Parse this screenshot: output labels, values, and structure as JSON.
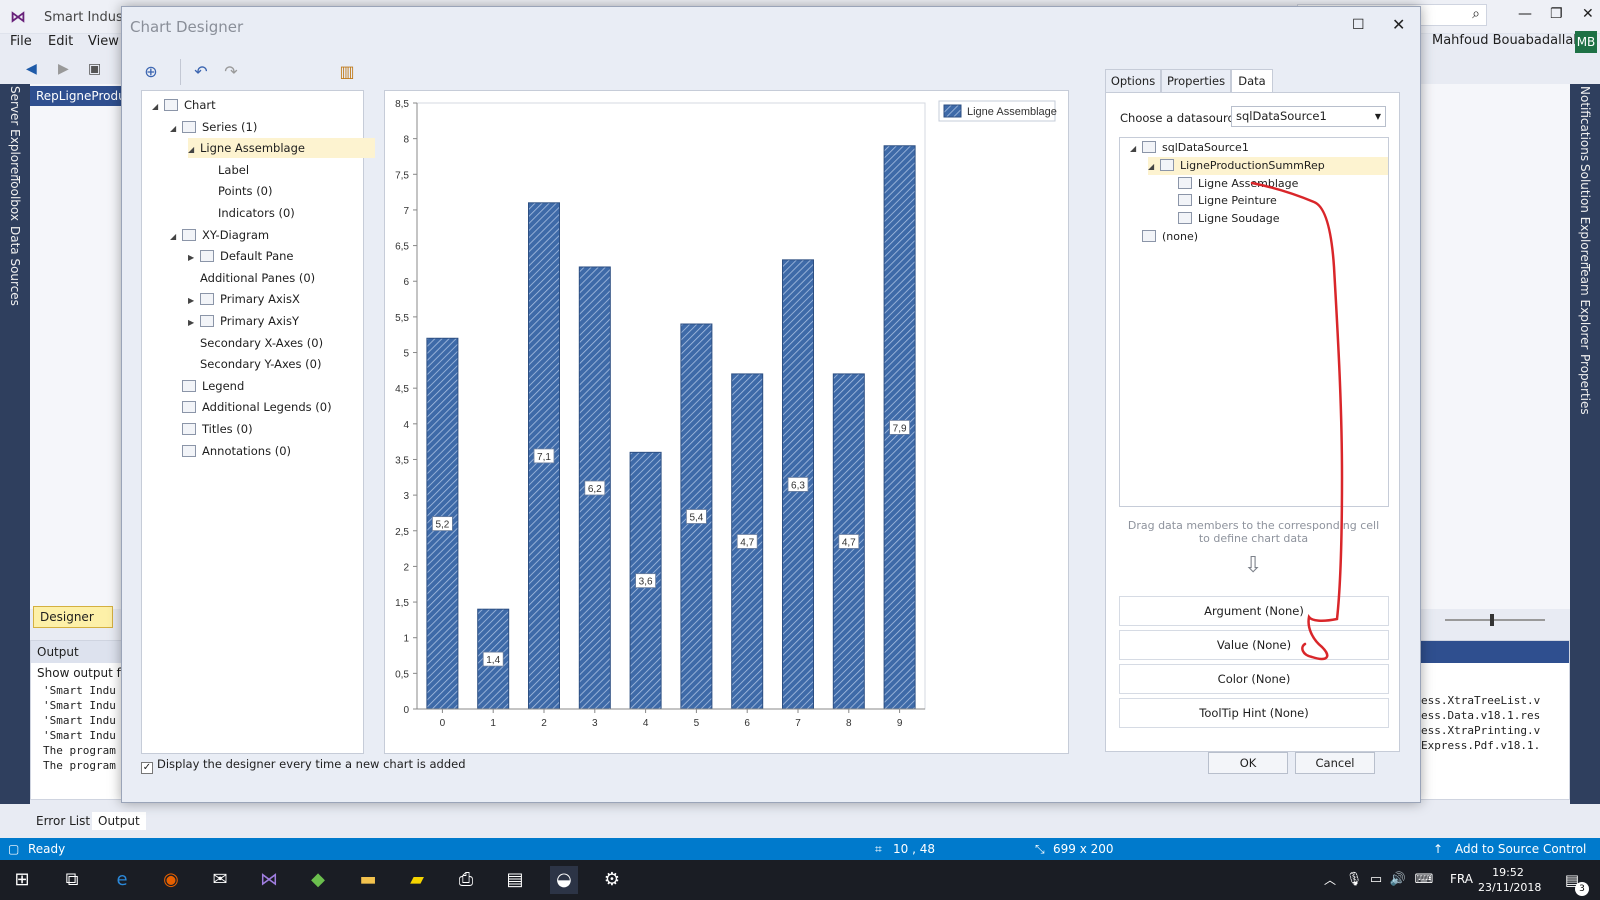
{
  "vs": {
    "app_title": "Smart Industria",
    "menu": [
      "File",
      "Edit",
      "View"
    ],
    "user": "Mahfoud Bouabadallah",
    "user_initials": "MB",
    "doc_tab": "RepLigneProduc",
    "left_strip": [
      "Server Explorer",
      "Toolbox",
      "Data Sources"
    ],
    "right_strip": [
      "Notifications",
      "Solution Explorer",
      "Team Explorer",
      "Properties"
    ],
    "designer_tab": "Designer",
    "output": {
      "title": "Output",
      "show_from": "Show output fro",
      "lines": [
        "'Smart Indu",
        "'Smart Indu",
        "'Smart Indu",
        "'Smart Indu",
        "The program",
        "The program"
      ],
      "right_lines": [
        "ess.XtraTreeList.v",
        "ess.Data.v18.1.res",
        "ess.XtraPrinting.v",
        "Express.Pdf.v18.1."
      ]
    },
    "bottom_tabs": [
      "Error List",
      "Output"
    ],
    "status": {
      "ready": "Ready",
      "position": "10 , 48",
      "size": "699 x 200",
      "source_control": "Add to Source Control"
    },
    "taskbar": {
      "lang": "FRA",
      "time": "19:52",
      "date": "23/11/2018",
      "badge": "3"
    }
  },
  "dialog": {
    "title": "Chart Designer",
    "tree": [
      {
        "label": "Chart",
        "arrow": "◢"
      },
      {
        "label": "Series (1)",
        "arrow": "◢"
      },
      {
        "label": "Ligne Assemblage",
        "arrow": "◢"
      },
      {
        "label": "Label",
        "arrow": ""
      },
      {
        "label": "Points (0)",
        "arrow": ""
      },
      {
        "label": "Indicators (0)",
        "arrow": ""
      },
      {
        "label": "XY-Diagram",
        "arrow": "◢"
      },
      {
        "label": "Default Pane",
        "arrow": "▶"
      },
      {
        "label": "Additional Panes (0)",
        "arrow": ""
      },
      {
        "label": "Primary AxisX",
        "arrow": "▶"
      },
      {
        "label": "Primary AxisY",
        "arrow": "▶"
      },
      {
        "label": "Secondary X-Axes (0)",
        "arrow": ""
      },
      {
        "label": "Secondary Y-Axes (0)",
        "arrow": ""
      },
      {
        "label": "Legend",
        "arrow": ""
      },
      {
        "label": "Additional Legends (0)",
        "arrow": ""
      },
      {
        "label": "Titles (0)",
        "arrow": ""
      },
      {
        "label": "Annotations (0)",
        "arrow": ""
      }
    ],
    "tabs": [
      "Options",
      "Properties",
      "Data"
    ],
    "active_tab": "Data",
    "datasource_label": "Choose a datasource:",
    "datasource_value": "sqlDataSource1",
    "ds_tree": [
      {
        "label": "sqlDataSource1",
        "arrow": "◢"
      },
      {
        "label": "LigneProductionSummRep",
        "arrow": "◢"
      },
      {
        "label": "Ligne Assemblage",
        "arrow": ""
      },
      {
        "label": "Ligne Peinture",
        "arrow": ""
      },
      {
        "label": "Ligne Soudage",
        "arrow": ""
      },
      {
        "label": "(none)",
        "arrow": ""
      }
    ],
    "drag_hint": "Drag data members to the corresponding cell to define chart data",
    "cells": [
      "Argument (None)",
      "Value (None)",
      "Color (None)",
      "ToolTip Hint (None)"
    ],
    "checkbox_label": "Display the designer every time a new chart is added",
    "ok": "OK",
    "cancel": "Cancel",
    "annotation_color": "#d9262a",
    "bar_color": "#3e6aa8"
  },
  "chart_data": {
    "type": "bar",
    "categories": [
      "0",
      "1",
      "2",
      "3",
      "4",
      "5",
      "6",
      "7",
      "8",
      "9"
    ],
    "series": [
      {
        "name": "Ligne Assemblage",
        "values": [
          5.2,
          1.4,
          7.1,
          6.2,
          3.6,
          5.4,
          4.7,
          6.3,
          4.7,
          7.9
        ]
      }
    ],
    "data_labels": [
      "5,2",
      "1,4",
      "7,1",
      "6,2",
      "3,6",
      "5,4",
      "4,7",
      "6,3",
      "4,7",
      "7,9"
    ],
    "y_ticks": [
      "0",
      "0,5",
      "1",
      "1,5",
      "2",
      "2,5",
      "3",
      "3,5",
      "4",
      "4,5",
      "5",
      "5,5",
      "6",
      "6,5",
      "7",
      "7,5",
      "8",
      "8,5"
    ],
    "ylim": [
      0,
      8.5
    ],
    "legend_position": "top-right",
    "title": "",
    "xlabel": "",
    "ylabel": ""
  }
}
